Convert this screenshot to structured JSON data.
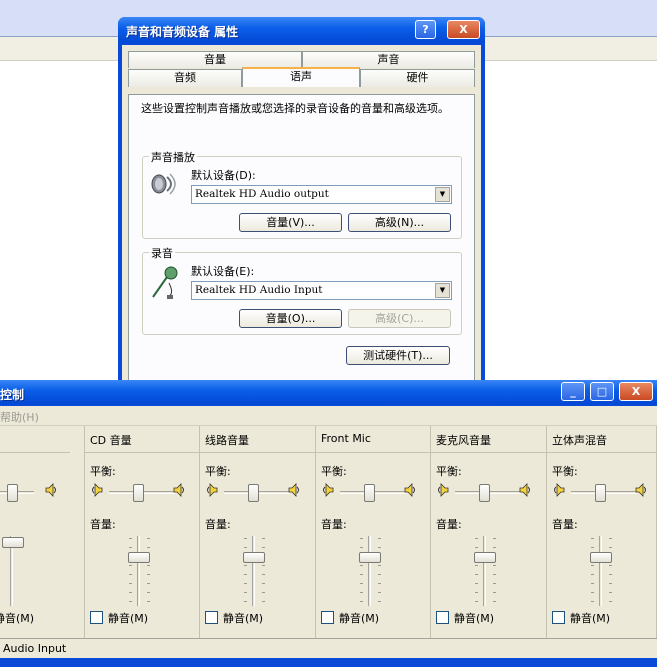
{
  "dialog": {
    "title": "声音和音频设备 属性",
    "help_btn": "?",
    "close_btn": "X",
    "tabs_back": [
      "音量",
      "声音"
    ],
    "tabs_front": [
      "音频",
      "语声",
      "硬件"
    ],
    "description": "这些设置控制声音播放或您选择的录音设备的音量和高级选项。",
    "playback": {
      "group_label": "声音播放",
      "device_label": "默认设备(D):",
      "device_value": "Realtek HD Audio output",
      "volume_btn": "音量(V)...",
      "advanced_btn": "高级(N)..."
    },
    "recording": {
      "group_label": "录音",
      "device_label": "默认设备(E):",
      "device_value": "Realtek HD Audio Input",
      "volume_btn": "音量(O)...",
      "advanced_btn": "高级(C)..."
    },
    "test_hardware_btn": "测试硬件(T)..."
  },
  "volume_window": {
    "title": "控制",
    "menu_help": "帮助(H)",
    "minimize": "_",
    "maximize": "□",
    "close": "X",
    "balance_label": "平衡:",
    "volume_label": "音量:",
    "mute_label": "静音(M)",
    "partial_mute_label": "静音(M)",
    "columns": [
      "CD 音量",
      "线路音量",
      "Front Mic",
      "麦克风音量",
      "立体声混音"
    ],
    "status": "Audio Input"
  },
  "colors": {
    "xp_blue": "#0a4ad8",
    "face": "#ece9d8"
  },
  "icons": [
    "speaker-icon",
    "microphone-icon",
    "speaker-small-icon"
  ]
}
